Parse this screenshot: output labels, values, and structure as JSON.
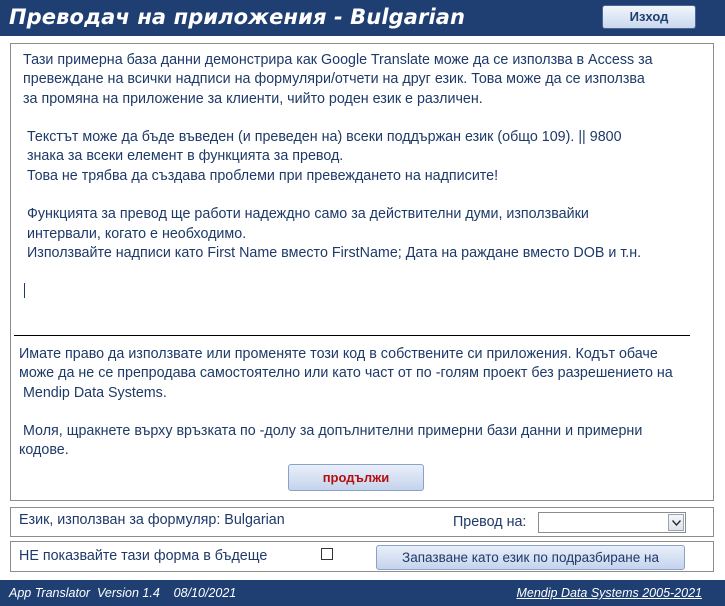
{
  "header": {
    "title": "Преводач на приложения - Bulgarian",
    "exit_label": "Изход"
  },
  "main": {
    "description": "Тази примерна база данни демонстрира как Google Translate може да се използва в Access за\nпревеждане на всички надписи на формуляри/отчети на друг език. Това може да се използва\nза промяна на приложение за клиенти, чийто роден език е различен.\n\n Текстът може да бъде въведен (и преведен на) всеки поддържан език (общо 109). || 9800\n знака за всеки елемент в функцията за превод.\n Това не трябва да създава проблеми при превеждането на надписите!\n\n Функцията за превод ще работи надеждно само за действителни думи, използвайки\n интервали, когато е необходимо.\n Използвайте надписи като First Name вместо FirstName; Дата на раждане вместо DOB и т.н.",
    "license": "Имате право да използвате или променяте този код в собствените си приложения. Кодът обаче\nможе да не се препродава самостоятелно или като част от по -голям проект без разрешението на\n Mendip Data Systems.\n\n Моля, щракнете върху връзката по -долу за допълнителни примерни бази данни и примерни\nкодове.",
    "continue_label": "продължи"
  },
  "settings": {
    "form_language_label": "Език, използван за формуляр: Bulgarian",
    "translate_to_label": "Превод на:",
    "translate_to_value": "",
    "dont_show_label": "НЕ показвайте тази форма в бъдеще",
    "dont_show_checked": false,
    "save_default_label": "Запазване като език по подразбиране на"
  },
  "footer": {
    "version_text": "App Translator  Version 1.4    08/10/2021",
    "company_link": "Mendip Data Systems 2005-2021"
  },
  "colors": {
    "title_bar": "#1f3f73",
    "body_text": "#1e3a68",
    "continue_text": "#b51010"
  }
}
